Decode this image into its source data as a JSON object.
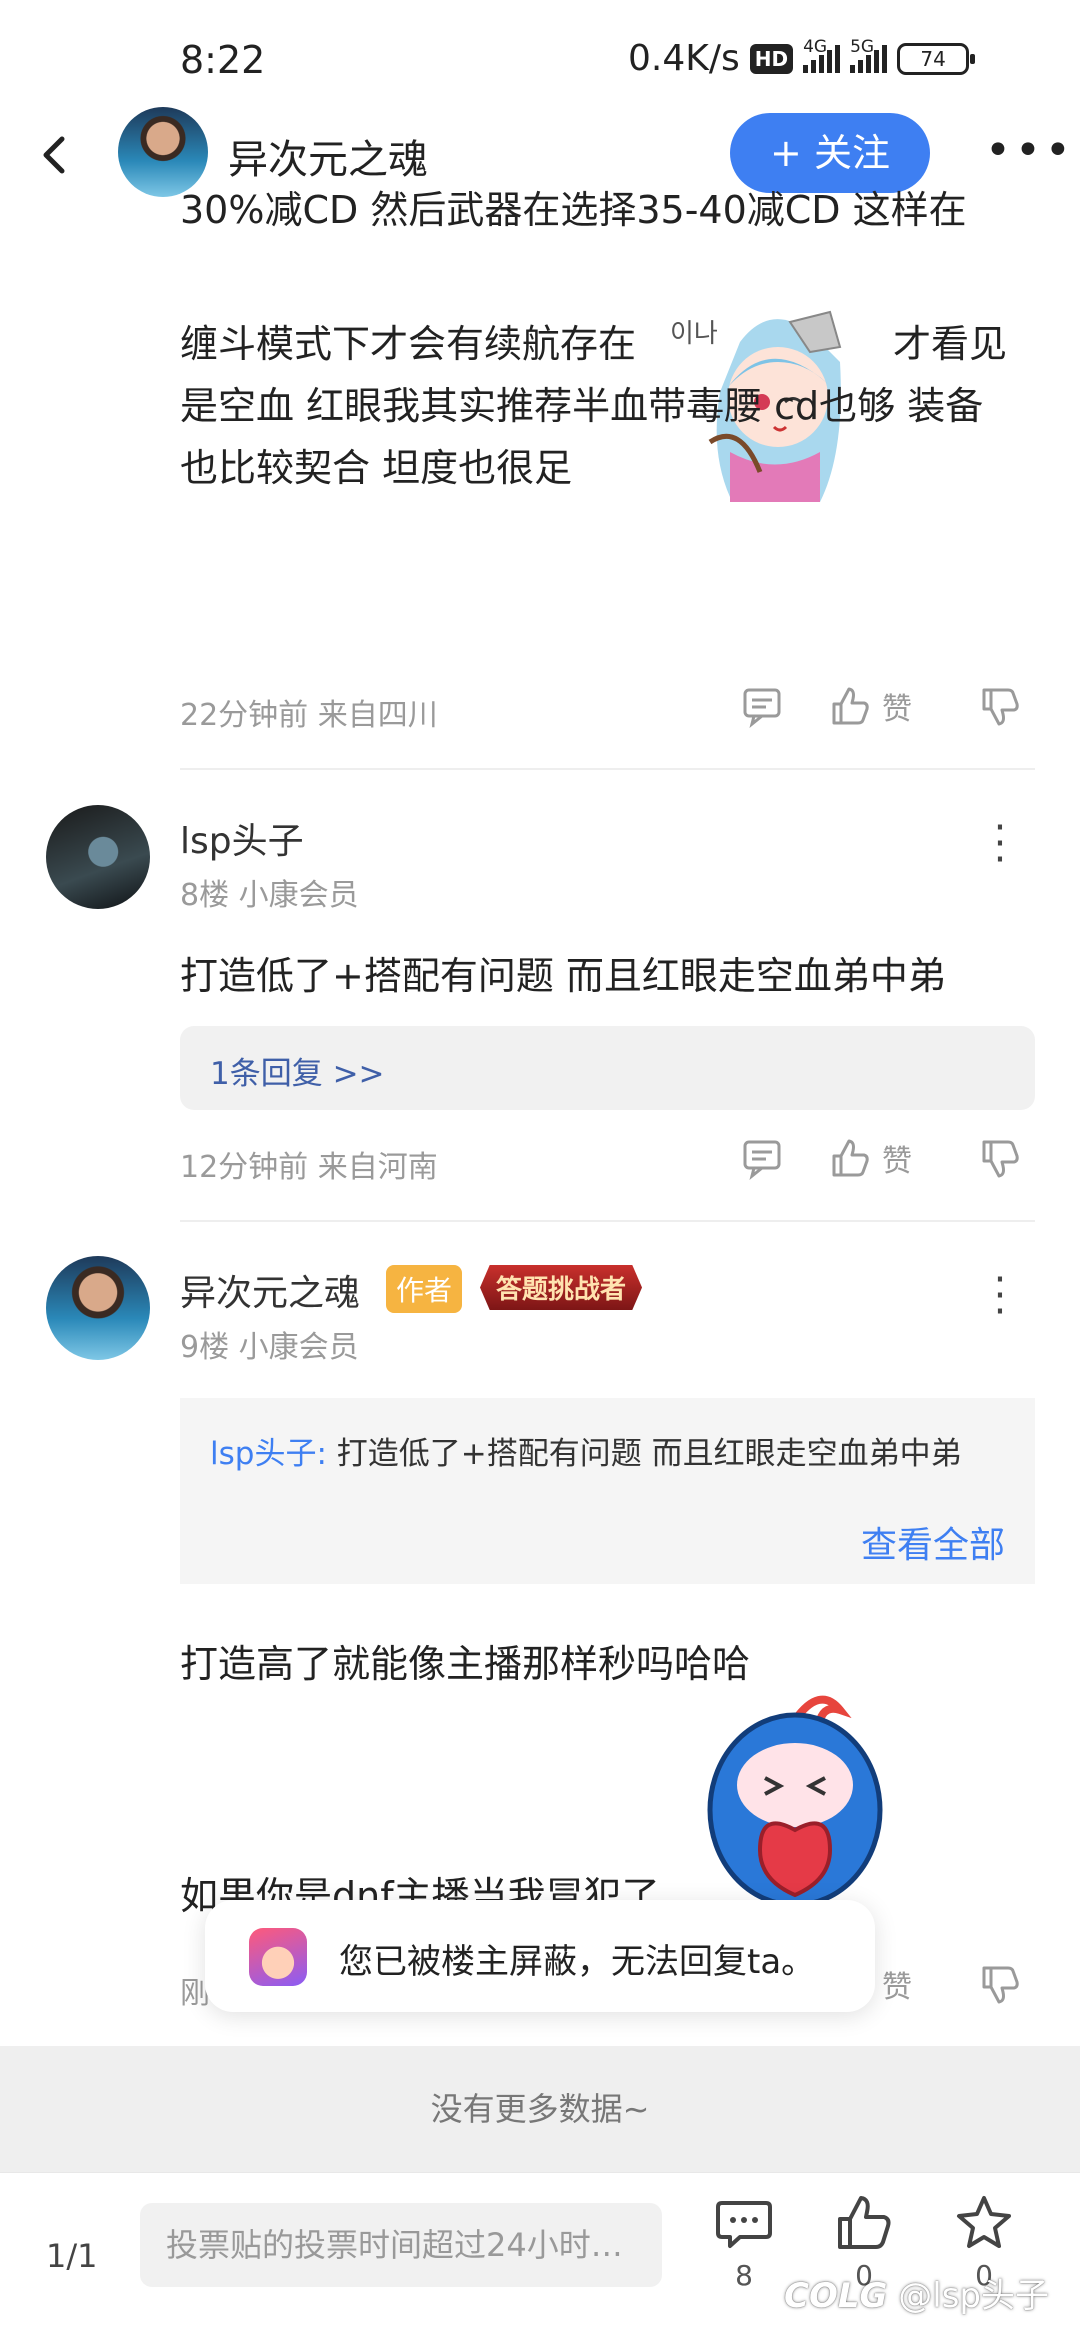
{
  "status_bar": {
    "time": "8:22",
    "speed": "0.4K/s",
    "hd_label": "HD",
    "net1": "4G",
    "net2": "5G",
    "battery": "74"
  },
  "header": {
    "username": "异次元之魂",
    "follow_label": "+ 关注",
    "more_label": "•••"
  },
  "post": {
    "line1": "30%减CD 然后武器在选择35-40减CD 这样在",
    "line2_pre": "缠斗模式下才会有续航存在",
    "line2_post": "才看见",
    "line3": "是空血 红眼我其实推荐半血带毒腰 cd也够 装备",
    "line4": "也比较契合 坦度也很足",
    "meta": "22分钟前 来自四川",
    "like_label": "赞"
  },
  "comments": [
    {
      "name": "lsp头子",
      "floor": "8楼 小康会员",
      "text": "打造低了+搭配有问题 而且红眼走空血弟中弟",
      "reply_link": "1条回复 >>",
      "meta": "12分钟前 来自河南",
      "like_label": "赞"
    },
    {
      "name": "异次元之魂",
      "badge_author": "作者",
      "badge_challenge": "答题挑战者",
      "floor": "9楼 小康会员",
      "quote_user": "lsp头子:",
      "quote_text": " 打造低了+搭配有问题 而且红眼走空血弟中弟",
      "quote_all": "查看全部",
      "text1": "打造高了就能像主播那样秒吗哈哈",
      "text2": "如果你是dnf主播当我冒犯了",
      "meta": "刚",
      "like_label": "赞"
    }
  ],
  "toast": {
    "text": "您已被楼主屏蔽，无法回复ta。"
  },
  "list_end": "没有更多数据~",
  "bottom_bar": {
    "page": "1/1",
    "input_placeholder": "投票贴的投票时间超过24小时…",
    "comment_count": "8",
    "like_count": "0",
    "fav_count": "0"
  },
  "watermark": {
    "logo": "COLG",
    "text": "@lsp头子"
  },
  "colors": {
    "accent": "#3e7ff2",
    "link": "#3f5fa8",
    "meta": "#9a9a9a"
  }
}
